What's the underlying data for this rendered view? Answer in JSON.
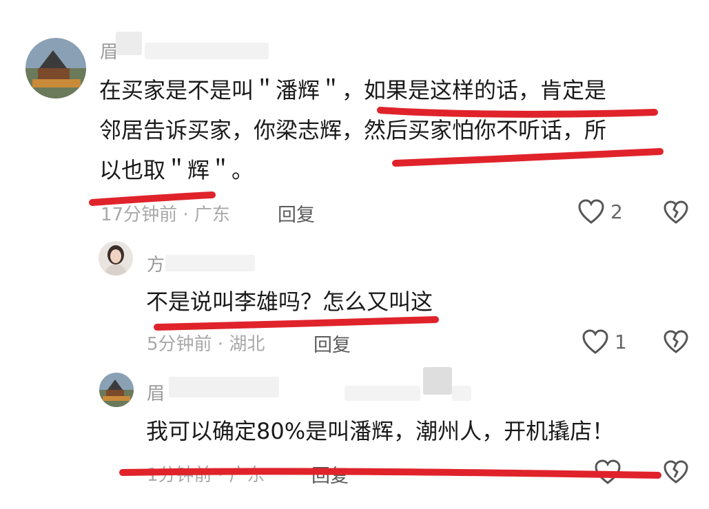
{
  "comments": [
    {
      "username": "眉",
      "text_lines": [
        "在买家是不是叫＂潘辉＂，如果是这样的话，肯定是",
        "邻居告诉买家，你梁志辉，然后买家怕你不听话，所",
        "以也取＂辉＂。"
      ],
      "meta": "17分钟前 · 广东",
      "reply_label": "回复",
      "like_count": "2"
    },
    {
      "username": "方",
      "text_lines": [
        "不是说叫李雄吗？怎么又叫这"
      ],
      "meta": "5分钟前 · 湖北",
      "reply_label": "回复",
      "like_count": "1"
    },
    {
      "username": "眉",
      "text_lines": [
        "我可以确定80%是叫潘辉，潮州人，开机撬店！"
      ],
      "meta": "1分钟前 · 广东",
      "reply_label": "回复",
      "like_count": ""
    }
  ],
  "icons": {
    "like": "heart-outline-icon",
    "dislike": "broken-heart-icon"
  },
  "colors": {
    "annotation_stroke": "#e0232b",
    "meta_text": "#a8a8a8",
    "body_text": "#1a1a1a"
  }
}
